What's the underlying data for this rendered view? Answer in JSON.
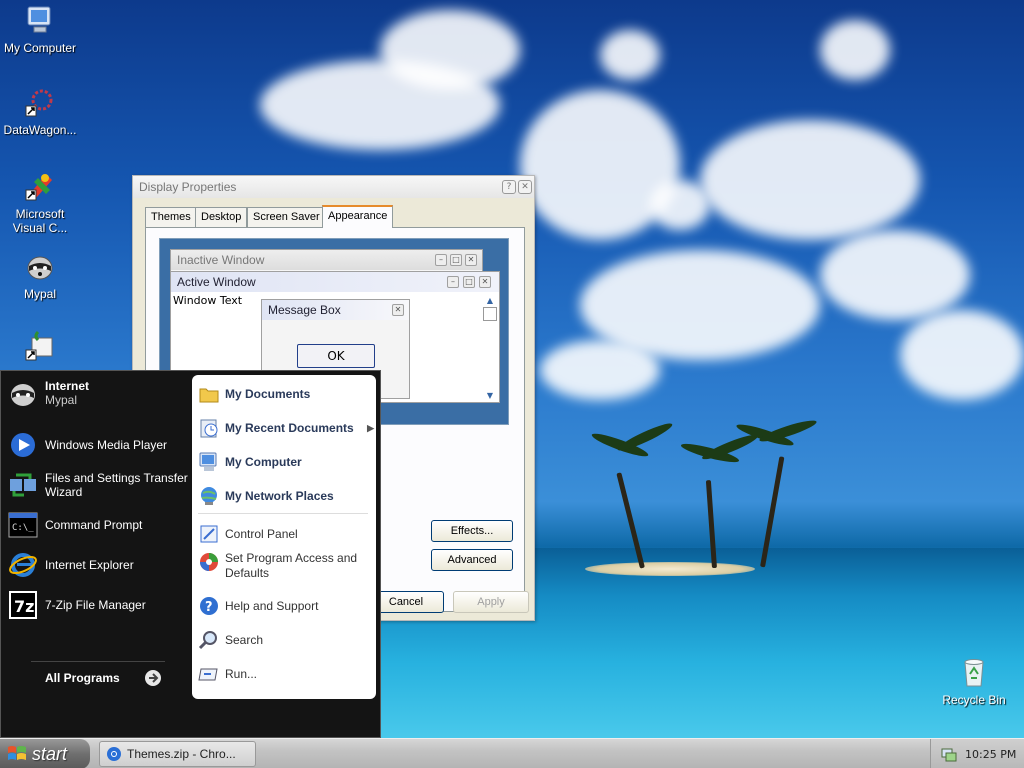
{
  "desktop": {
    "icons": [
      {
        "label": "My Computer",
        "icon": "my-computer-icon"
      },
      {
        "label": "DataWagon...",
        "icon": "datawagon-icon"
      },
      {
        "label": "Microsoft Visual C...",
        "icon": "visual-studio-icon"
      },
      {
        "label": "Mypal",
        "icon": "mypal-icon"
      },
      {
        "label": "",
        "icon": "shortcut-icon"
      },
      {
        "label": "Recycle Bin",
        "icon": "recycle-bin-icon"
      }
    ]
  },
  "dialog": {
    "title": "Display Properties",
    "tabs": [
      "Themes",
      "Desktop",
      "Screen Saver",
      "Appearance"
    ],
    "active_tab": "Appearance",
    "preview": {
      "inactive_title": "Inactive Window",
      "active_title": "Active Window",
      "window_text": "Window Text",
      "message_box_title": "Message Box",
      "ok_label": "OK"
    },
    "effects_label": "Effects...",
    "advanced_label": "Advanced",
    "cancel_label": "Cancel",
    "apply_label": "Apply"
  },
  "start_menu": {
    "pinned": {
      "title": "Internet",
      "subtitle": "Mypal"
    },
    "left_items": [
      "Windows Media Player",
      "Files and Settings Transfer Wizard",
      "Command Prompt",
      "Internet Explorer",
      "7-Zip File Manager"
    ],
    "all_programs": "All Programs",
    "right_items": [
      "My Documents",
      "My Recent Documents",
      "My Computer",
      "My Network Places",
      "Control Panel",
      "Set Program Access and Defaults",
      "Help and Support",
      "Search",
      "Run..."
    ]
  },
  "taskbar": {
    "start_label": "start",
    "task_button": "Themes.zip - Chro...",
    "clock": "10:25 PM"
  }
}
